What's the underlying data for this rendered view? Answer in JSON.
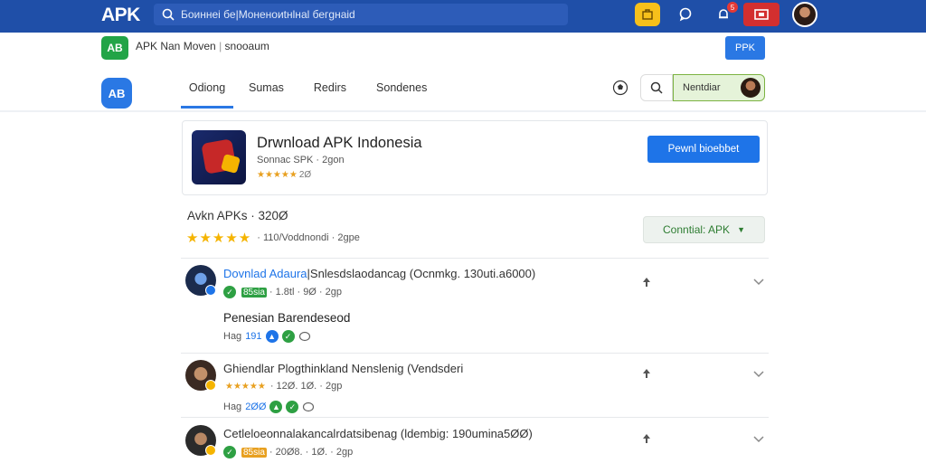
{
  "header": {
    "logo": "APK",
    "search_placeholder": "Боиннеі бе|Мoнeнoиtнlнal бегgнаіd",
    "notification_count": "5",
    "icons": [
      "search-icon",
      "shop-icon",
      "chat-icon",
      "bell-icon",
      "video-icon",
      "user-avatar"
    ]
  },
  "subheader": {
    "icon_text": "AB",
    "title": "APK Nan Moven",
    "separator": "|",
    "subtitle": "snooaum",
    "button_label": "PPK"
  },
  "nav": {
    "logo_text": "AB",
    "tabs": [
      {
        "label": "Odiong",
        "active": true
      },
      {
        "label": "Sumas",
        "active": false
      },
      {
        "label": "Redirs",
        "active": false
      },
      {
        "label": "Sondenes",
        "active": false
      }
    ],
    "signin_label": "Nentdiar"
  },
  "app": {
    "title": "Drwnload APK Indonesia",
    "subtitle": "Sonnac SPK · 2gon",
    "stars": "★★★★★",
    "rating": "2Ø",
    "download_label": "Pewnl bioebbet"
  },
  "summary": {
    "title": "Avkn APKs · 320Ø",
    "stars": "★★★★★",
    "meta": "· 110/Voddnondi · 2gpe",
    "button_label": "Conntial: APK"
  },
  "reviews": [
    {
      "title_blue": "Dovnlad Adaura",
      "title_rest": "|Snlesdslaodancag (Ocnmkg. 130uti.a6000)",
      "chip": "85sia",
      "meta": "· 1.8tl · 9Ø · 2gp",
      "body": "Penesian Barendeseod",
      "foot_label": "Hag",
      "foot_value": "191",
      "colors": {
        "avatar": "#1b2b4d",
        "badge": "#1e74e8",
        "chip": "#2ea043"
      }
    },
    {
      "title_blue": "",
      "title_rest": "Ghiendlar Plogthinkland Nenslenig (Vendsderi",
      "chip": "★★★★★",
      "meta": "· 12Ø. 1Ø. · 2gp",
      "body": "",
      "foot_label": "Hag",
      "foot_value": "2ØØ",
      "colors": {
        "avatar": "#3b2a22",
        "badge": "#f5b400",
        "chip": "#e8a020"
      }
    },
    {
      "title_blue": "",
      "title_rest": "Cetleloeonnalakancalrdatsibenag (ldembig: 190umina5ØØ)",
      "chip": "85sia",
      "meta": "· 20Ø8. · 1Ø. · 2gp",
      "body": "",
      "foot_label": "",
      "foot_value": "",
      "colors": {
        "avatar": "#2b2b2b",
        "badge": "#f5b400",
        "chip": "#e8a020"
      }
    }
  ]
}
